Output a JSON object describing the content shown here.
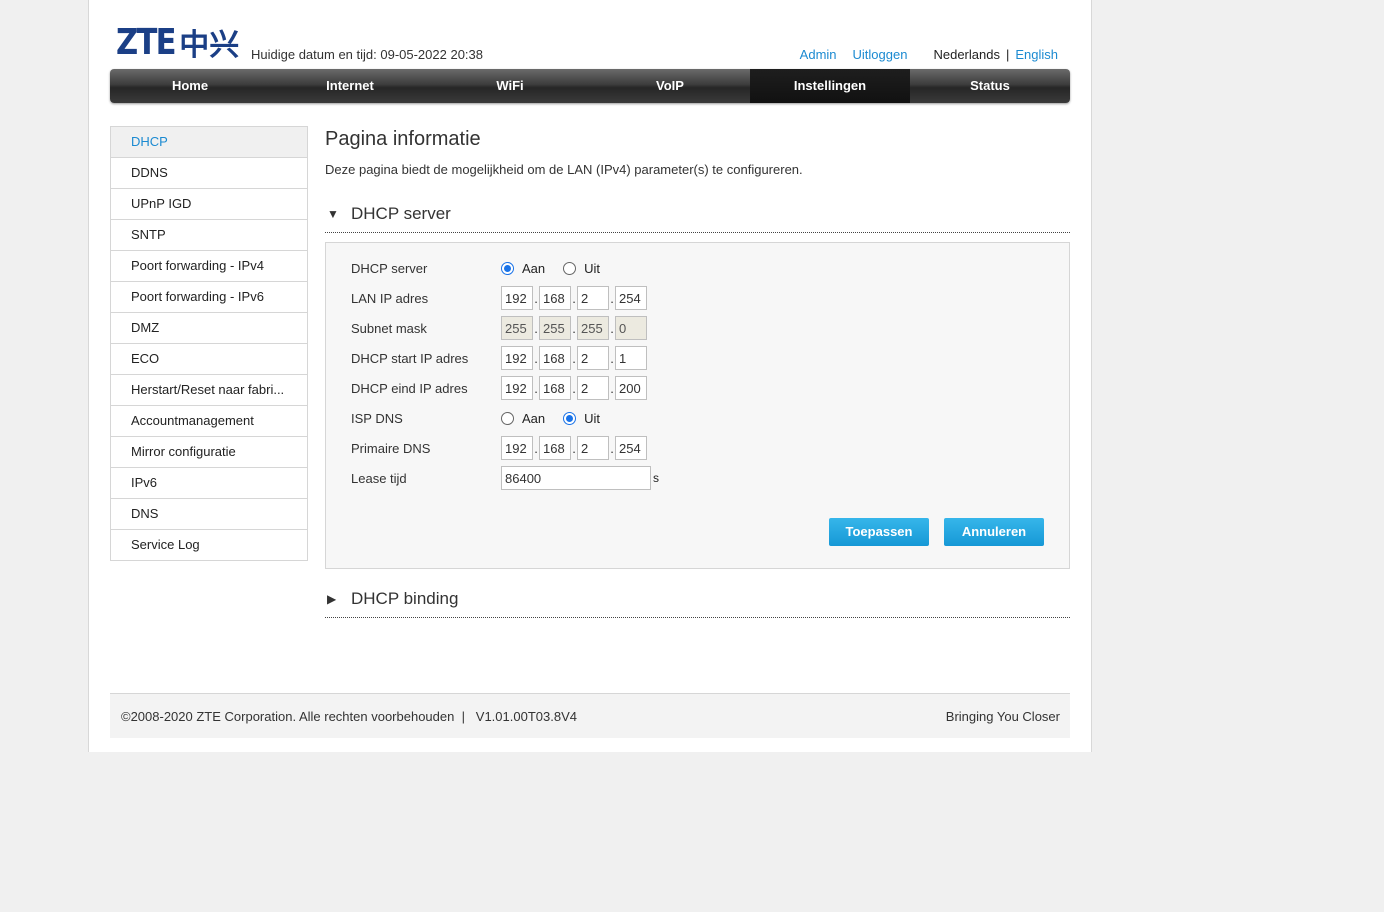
{
  "header": {
    "logo_latin": "ZTE",
    "logo_cn": "中兴",
    "datetime": "Huidige datum en tijd: 09-05-2022 20:38",
    "admin": "Admin",
    "logout": "Uitloggen",
    "lang_nl": "Nederlands",
    "lang_sep": "|",
    "lang_en": "English"
  },
  "nav": {
    "items": [
      "Home",
      "Internet",
      "WiFi",
      "VoIP",
      "Instellingen",
      "Status"
    ],
    "active": "Instellingen"
  },
  "sidebar": {
    "items": [
      "DHCP",
      "DDNS",
      "UPnP IGD",
      "SNTP",
      "Poort forwarding - IPv4",
      "Poort forwarding - IPv6",
      "DMZ",
      "ECO",
      "Herstart/Reset naar fabri...",
      "Accountmanagement",
      "Mirror configuratie",
      "IPv6",
      "DNS",
      "Service Log"
    ],
    "active": "DHCP"
  },
  "main": {
    "title": "Pagina informatie",
    "description": "Deze pagina biedt de mogelijkheid om de LAN (IPv4) parameter(s) te configureren.",
    "section1": {
      "arrow": "▼",
      "title": "DHCP server"
    },
    "section2": {
      "arrow": "▶",
      "title": "DHCP binding"
    }
  },
  "form": {
    "dhcp_server": {
      "label": "DHCP server",
      "opt_on": "Aan",
      "opt_off": "Uit",
      "selected": "Aan"
    },
    "lan_ip": {
      "label": "LAN IP adres",
      "octets": [
        "192",
        "168",
        "2",
        "254"
      ]
    },
    "subnet": {
      "label": "Subnet mask",
      "octets": [
        "255",
        "255",
        "255",
        "0"
      ]
    },
    "start_ip": {
      "label": "DHCP start IP adres",
      "octets": [
        "192",
        "168",
        "2",
        "1"
      ]
    },
    "end_ip": {
      "label": "DHCP eind IP adres",
      "octets": [
        "192",
        "168",
        "2",
        "200"
      ]
    },
    "isp_dns": {
      "label": "ISP DNS",
      "opt_on": "Aan",
      "opt_off": "Uit",
      "selected": "Uit"
    },
    "primary_dns": {
      "label": "Primaire DNS",
      "octets": [
        "192",
        "168",
        "2",
        "254"
      ]
    },
    "lease": {
      "label": "Lease tijd",
      "value": "86400",
      "unit": "s"
    },
    "apply": "Toepassen",
    "cancel": "Annuleren"
  },
  "footer": {
    "copyright": "©2008-2020 ZTE Corporation. Alle rechten voorbehouden  |   V1.01.00T03.8V4",
    "slogan": "Bringing You Closer"
  },
  "colors": {
    "accent": "#1b8ad1",
    "button": "#1698d6",
    "nav_bg": "#3d3d3d",
    "logo": "#1b3f86"
  }
}
